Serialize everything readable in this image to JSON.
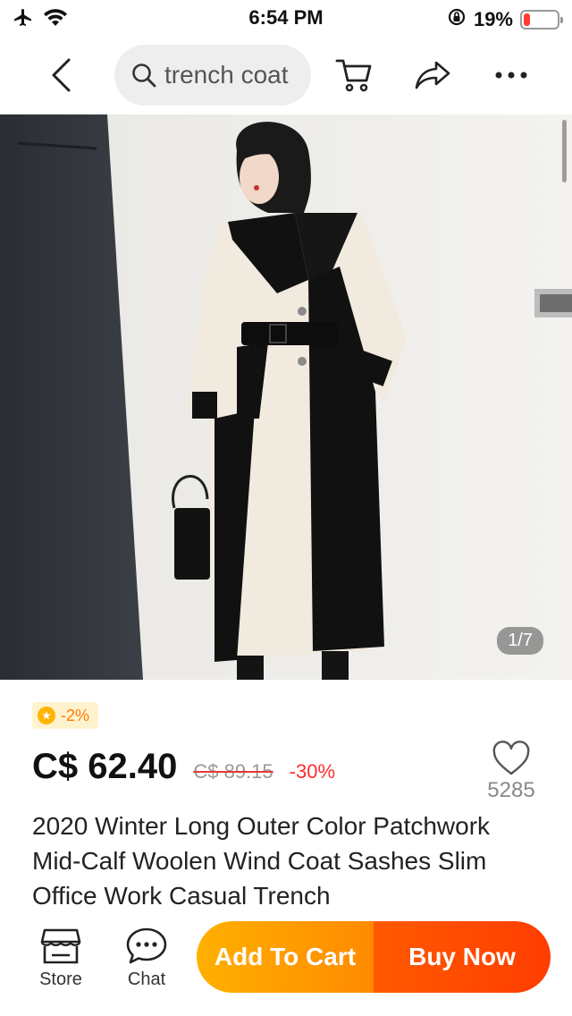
{
  "status_bar": {
    "time": "6:54 PM",
    "battery_percent": "19%",
    "battery_level": 0.19,
    "icons": [
      "airplane-icon",
      "wifi-icon",
      "rotation-lock-icon",
      "battery-icon"
    ]
  },
  "nav": {
    "search_query": "trench coat",
    "icons": [
      "back-icon",
      "search-icon",
      "cart-icon",
      "share-icon",
      "more-icon"
    ]
  },
  "product": {
    "image_counter": "1/7",
    "coin_discount": "-2%",
    "price": "C$ 62.40",
    "original_price": "C$ 89.15",
    "discount": "-30%",
    "wishlist_count": "5285",
    "title": "2020 Winter Long Outer Color Patchwork Mid-Calf Woolen Wind Coat Sashes Slim Office Work Casual Trench"
  },
  "bottom_bar": {
    "store_label": "Store",
    "chat_label": "Chat",
    "add_to_cart_label": "Add To Cart",
    "buy_now_label": "Buy Now"
  },
  "colors": {
    "accent_orange": "#ff8a00",
    "buy_red": "#ff3d00",
    "discount_red": "#ff2d2d",
    "coin_yellow": "#ffb400"
  }
}
